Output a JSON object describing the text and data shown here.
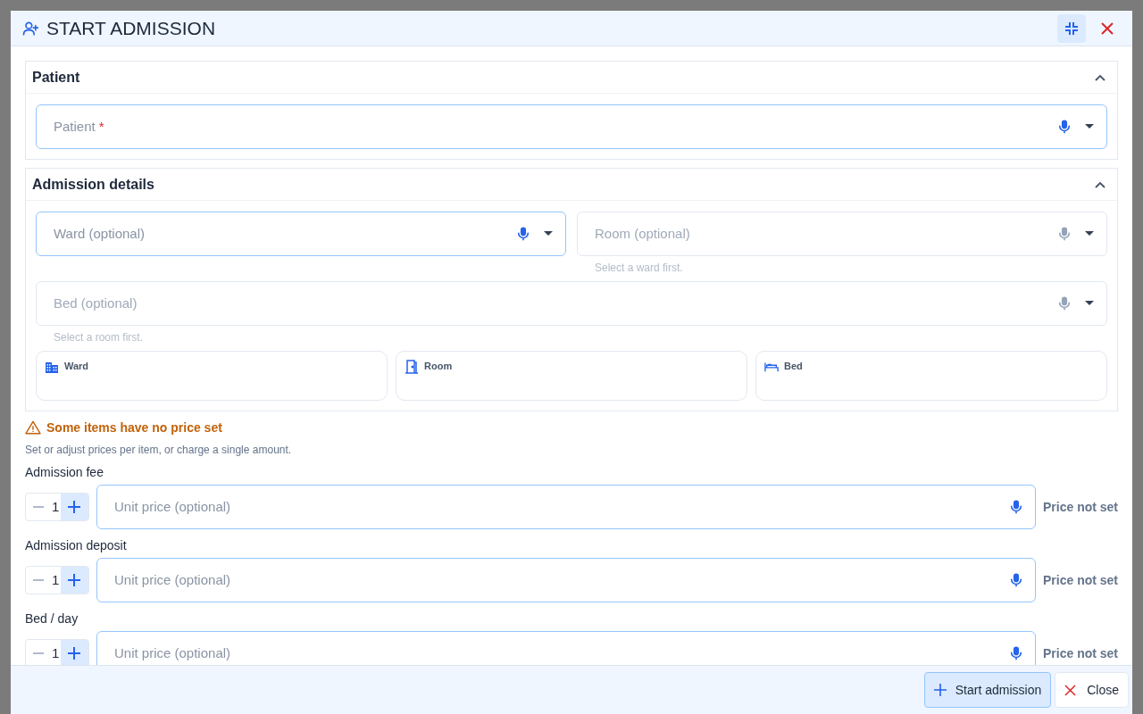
{
  "dialog": {
    "title": "START ADMISSION"
  },
  "patient_section": {
    "title": "Patient",
    "expanded": true,
    "fields": [
      {
        "label": "Patient",
        "required_mark": "*",
        "active": true,
        "disabled": false
      }
    ]
  },
  "details_section": {
    "title": "Admission details",
    "expanded": true,
    "fields": [
      {
        "label": "Ward (optional)",
        "active": true,
        "disabled": false
      },
      {
        "label": "Room (optional)",
        "active": false,
        "disabled": true,
        "helper": "Select a ward first."
      },
      {
        "label": "Bed (optional)",
        "active": false,
        "disabled": true,
        "helper": "Select a room first."
      }
    ],
    "summary_cards": [
      {
        "kind": "ward",
        "label": "Ward"
      },
      {
        "kind": "room",
        "label": "Room"
      },
      {
        "kind": "bed",
        "label": "Bed"
      }
    ]
  },
  "pricing": {
    "warning": "Some items have no price set",
    "hint": "Set or adjust prices per item, or charge a single amount.",
    "items": [
      {
        "label": "Admission fee",
        "quantity": "1",
        "placeholder": "Unit price (optional)",
        "price": "Price not set"
      },
      {
        "label": "Admission deposit",
        "quantity": "1",
        "placeholder": "Unit price (optional)",
        "price": "Price not set"
      },
      {
        "label": "Bed / day",
        "quantity": "1",
        "placeholder": "Unit price (optional)",
        "price": "Price not set"
      }
    ]
  },
  "footer_buttons": [
    {
      "kind": "primary",
      "label": "Start admission"
    },
    {
      "kind": "close",
      "label": "Close"
    }
  ]
}
